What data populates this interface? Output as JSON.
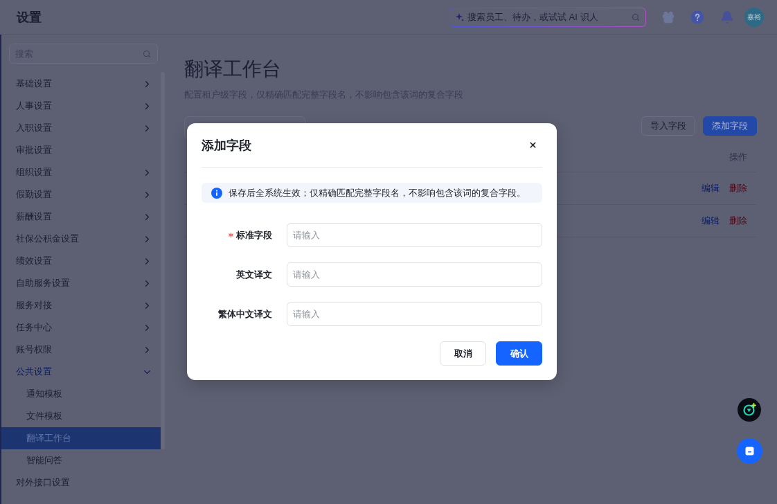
{
  "top_bar": {
    "title": "设置",
    "search": {
      "placeholder": "搜索员工、待办，或试试 AI 识人"
    },
    "avatar": {
      "initials": "嘉裕"
    }
  },
  "sidebar": {
    "search": {
      "placeholder": "搜索"
    },
    "items": [
      {
        "label": "基础设置",
        "kind": "group",
        "expanded": false,
        "selected": false
      },
      {
        "label": "人事设置",
        "kind": "group",
        "expanded": false,
        "selected": false
      },
      {
        "label": "入职设置",
        "kind": "group",
        "expanded": false,
        "selected": false
      },
      {
        "label": "审批设置",
        "kind": "page",
        "selected": false
      },
      {
        "label": "组织设置",
        "kind": "group",
        "expanded": false,
        "selected": false
      },
      {
        "label": "假勤设置",
        "kind": "group",
        "expanded": false,
        "selected": false
      },
      {
        "label": "薪酬设置",
        "kind": "group",
        "expanded": false,
        "selected": false
      },
      {
        "label": "社保公积金设置",
        "kind": "group",
        "expanded": false,
        "selected": false
      },
      {
        "label": "绩效设置",
        "kind": "group",
        "expanded": false,
        "selected": false
      },
      {
        "label": "自助服务设置",
        "kind": "group",
        "expanded": false,
        "selected": false
      },
      {
        "label": "服务对接",
        "kind": "group",
        "expanded": false,
        "selected": false
      },
      {
        "label": "任务中心",
        "kind": "group",
        "expanded": false,
        "selected": false
      },
      {
        "label": "账号权限",
        "kind": "group",
        "expanded": false,
        "selected": false
      },
      {
        "label": "公共设置",
        "kind": "group",
        "expanded": true,
        "selected": false,
        "children": [
          {
            "label": "通知模板",
            "selected": false
          },
          {
            "label": "文件模板",
            "selected": false
          },
          {
            "label": "翻译工作台",
            "selected": true
          },
          {
            "label": "智能问答",
            "selected": false
          }
        ]
      },
      {
        "label": "对外接口设置",
        "kind": "page",
        "selected": false
      }
    ]
  },
  "main": {
    "title": "翻译工作台",
    "subtitle": "配置租户级字段，仅精确匹配完整字段名，不影响包含该词的复合字段",
    "buttons": [
      {
        "label": "导入字段",
        "kind": "secondary"
      },
      {
        "label": "添加字段",
        "kind": "primary"
      }
    ],
    "table": {
      "columns": [
        {
          "label": "操作"
        }
      ],
      "rows": [
        {
          "actions": [
            {
              "label": "编辑",
              "kind": "edit"
            },
            {
              "label": "删除",
              "kind": "delete"
            }
          ]
        },
        {
          "actions": [
            {
              "label": "编辑",
              "kind": "edit"
            },
            {
              "label": "删除",
              "kind": "delete"
            }
          ]
        }
      ]
    }
  },
  "dialog": {
    "title": "添加字段",
    "notice": "保存后全系统生效；仅精确匹配完整字段名，不影响包含该词的复合字段。",
    "fields": [
      {
        "label": "标准字段",
        "required": true,
        "placeholder": "请输入"
      },
      {
        "label": "英文译文",
        "required": false,
        "placeholder": "请输入"
      },
      {
        "label": "繁体中文译文",
        "required": false,
        "placeholder": "请输入"
      }
    ],
    "buttons": [
      {
        "label": "取消",
        "kind": "secondary"
      },
      {
        "label": "确认",
        "kind": "primary"
      }
    ]
  }
}
